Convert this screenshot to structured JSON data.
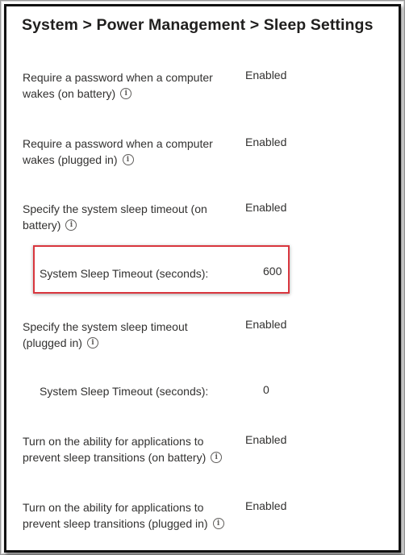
{
  "header": {
    "breadcrumb": "System > Power Management > Sleep Settings"
  },
  "settings": [
    {
      "label": "Require a password when a computer wakes (on battery)",
      "value": "Enabled"
    },
    {
      "label": "Require a password when a computer wakes (plugged in)",
      "value": "Enabled"
    },
    {
      "label": "Specify the system sleep timeout (on battery)",
      "value": "Enabled"
    },
    {
      "label": "System Sleep Timeout (seconds):",
      "value": "600"
    },
    {
      "label": "Specify the system sleep timeout (plugged in)",
      "value": "Enabled"
    },
    {
      "label": "System Sleep Timeout (seconds):",
      "value": "0"
    },
    {
      "label": "Turn on the ability for applications to prevent sleep transitions (on battery)",
      "value": "Enabled"
    },
    {
      "label": "Turn on the ability for applications to prevent sleep transitions (plugged in)",
      "value": "Enabled"
    }
  ],
  "info_icon_glyph": "i",
  "icons": {
    "info": "info-icon"
  },
  "colors": {
    "highlight_border": "#d9363e",
    "frame_border": "#111111"
  }
}
